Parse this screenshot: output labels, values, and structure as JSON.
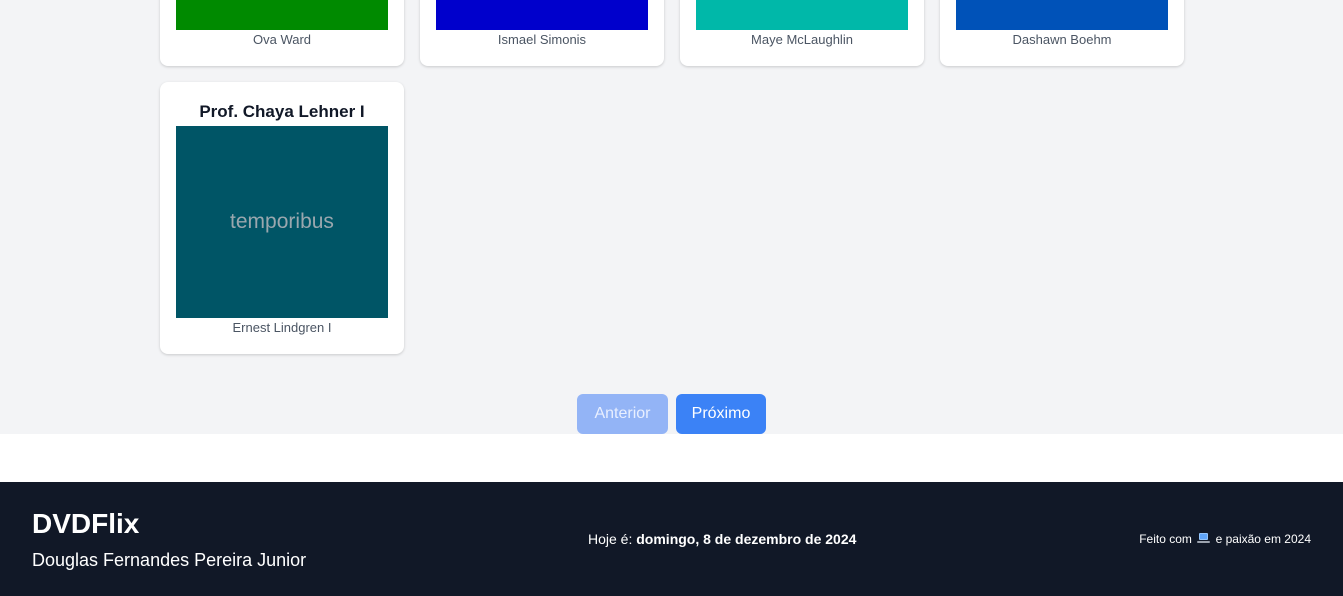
{
  "grid": {
    "row1": [
      {
        "author": "Ova Ward",
        "color": "#008a00"
      },
      {
        "author": "Ismael Simonis",
        "color": "#0000cc"
      },
      {
        "author": "Maye McLaughlin",
        "color": "#00b8a9"
      },
      {
        "author": "Dashawn Boehm",
        "color": "#0052b8"
      }
    ],
    "featured": {
      "title": "Prof. Chaya Lehner I",
      "image_text": "temporibus",
      "color": "#005566",
      "author": "Ernest Lindgren I"
    }
  },
  "pagination": {
    "prev_label": "Anterior",
    "next_label": "Próximo"
  },
  "footer": {
    "brand": "DVDFlix",
    "owner": "Douglas Fernandes Pereira Junior",
    "today_prefix": "Hoje é:",
    "today_date": "domingo, 8 de dezembro de 2024",
    "made_prefix": "Feito com",
    "made_icon": "laptop-icon",
    "made_suffix": "e paixão em 2024"
  }
}
